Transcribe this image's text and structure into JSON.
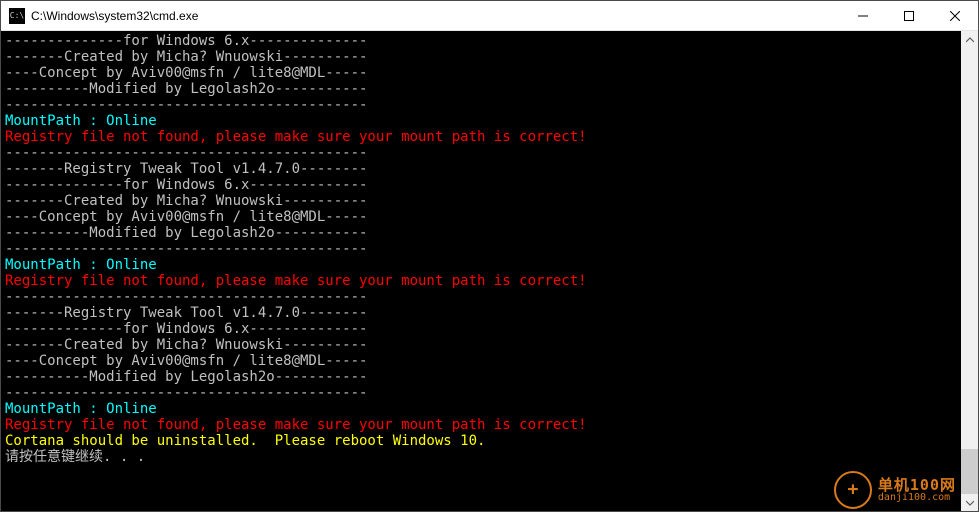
{
  "window": {
    "icon_glyph": "C:\\",
    "title": "C:\\Windows\\system32\\cmd.exe"
  },
  "lines": [
    {
      "cls": "c-gray",
      "text": "--------------for Windows 6.x--------------"
    },
    {
      "cls": "c-gray",
      "text": "-------Created by Micha? Wnuowski----------"
    },
    {
      "cls": "c-gray",
      "text": "----Concept by Aviv00@msfn / lite8@MDL-----"
    },
    {
      "cls": "c-gray",
      "text": "----------Modified by Legolash2o-----------"
    },
    {
      "cls": "c-gray",
      "text": "-------------------------------------------"
    },
    {
      "cls": "c-gray",
      "text": ""
    },
    {
      "cls": "c-cyan",
      "text": "MountPath : Online"
    },
    {
      "cls": "c-red",
      "text": "Registry file not found, please make sure your mount path is correct!"
    },
    {
      "cls": "c-gray",
      "text": "-------------------------------------------"
    },
    {
      "cls": "c-gray",
      "text": "-------Registry Tweak Tool v1.4.7.0--------"
    },
    {
      "cls": "c-gray",
      "text": "--------------for Windows 6.x--------------"
    },
    {
      "cls": "c-gray",
      "text": "-------Created by Micha? Wnuowski----------"
    },
    {
      "cls": "c-gray",
      "text": "----Concept by Aviv00@msfn / lite8@MDL-----"
    },
    {
      "cls": "c-gray",
      "text": "----------Modified by Legolash2o-----------"
    },
    {
      "cls": "c-gray",
      "text": "-------------------------------------------"
    },
    {
      "cls": "c-gray",
      "text": ""
    },
    {
      "cls": "c-cyan",
      "text": "MountPath : Online"
    },
    {
      "cls": "c-red",
      "text": "Registry file not found, please make sure your mount path is correct!"
    },
    {
      "cls": "c-gray",
      "text": "-------------------------------------------"
    },
    {
      "cls": "c-gray",
      "text": "-------Registry Tweak Tool v1.4.7.0--------"
    },
    {
      "cls": "c-gray",
      "text": "--------------for Windows 6.x--------------"
    },
    {
      "cls": "c-gray",
      "text": "-------Created by Micha? Wnuowski----------"
    },
    {
      "cls": "c-gray",
      "text": "----Concept by Aviv00@msfn / lite8@MDL-----"
    },
    {
      "cls": "c-gray",
      "text": "----------Modified by Legolash2o-----------"
    },
    {
      "cls": "c-gray",
      "text": "-------------------------------------------"
    },
    {
      "cls": "c-gray",
      "text": ""
    },
    {
      "cls": "c-cyan",
      "text": "MountPath : Online"
    },
    {
      "cls": "c-red",
      "text": "Registry file not found, please make sure your mount path is correct!"
    },
    {
      "cls": "c-yellow",
      "text": "Cortana should be uninstalled.  Please reboot Windows 10."
    },
    {
      "cls": "c-gray",
      "text": "请按任意键继续. . ."
    }
  ],
  "watermark": {
    "glyph": "+",
    "line1": "单机100网",
    "line2": "danji100.com"
  }
}
